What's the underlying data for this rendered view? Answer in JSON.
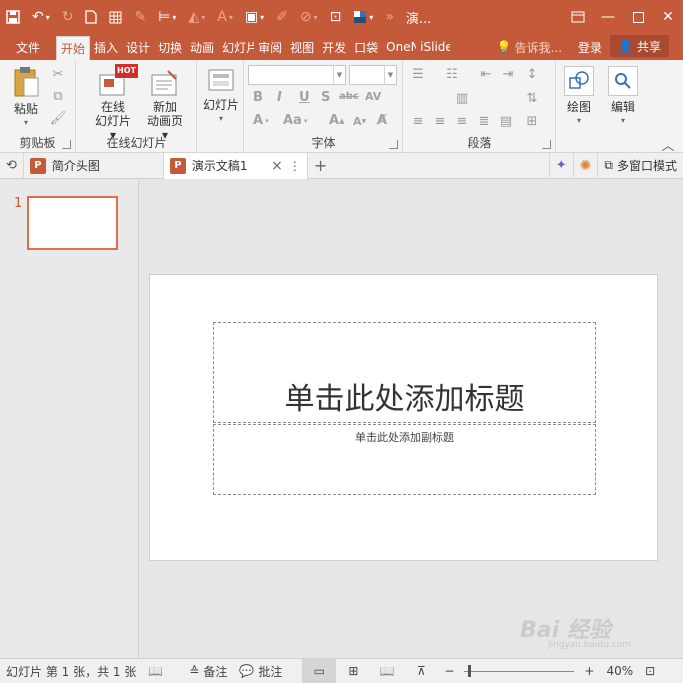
{
  "app": {
    "title": "演...",
    "share_label": "共享",
    "login_label": "登录",
    "tell_me": "告诉我..."
  },
  "quick_access": {
    "save": "save-icon",
    "undo": "undo-icon",
    "redo": "redo-icon"
  },
  "tabs": [
    "文件",
    "开始",
    "插入",
    "设计",
    "切换",
    "动画",
    "幻灯片",
    "审阅",
    "视图",
    "开发",
    "口袋",
    "OneN",
    "iSlide"
  ],
  "ribbon": {
    "clipboard": {
      "label": "剪贴板",
      "paste": "粘贴"
    },
    "online_slides": {
      "label": "在线幻灯片",
      "online": "在线",
      "online2": "幻灯片",
      "new_anim": "新加",
      "new_anim2": "动画页",
      "hot": "HOT"
    },
    "slides": {
      "slides_btn": "幻灯片"
    },
    "font": {
      "label": "字体",
      "bold": "B",
      "italic": "I",
      "underline": "U",
      "shadow": "S",
      "strike": "abc",
      "spacing": "AV",
      "size_up": "A",
      "size_down": "A",
      "case": "Aa"
    },
    "paragraph": {
      "label": "段落"
    },
    "drawing": {
      "draw": "绘图",
      "edit": "编辑"
    }
  },
  "doc_tabs": {
    "tab1": "简介头图",
    "tab2": "演示文稿1",
    "close": "×",
    "more": "⋮",
    "add": "+",
    "multi_window": "多窗口模式"
  },
  "thumbnail": {
    "number": "1"
  },
  "slide": {
    "title_placeholder": "单击此处添加标题",
    "subtitle_placeholder": "单击此处添加副标题"
  },
  "statusbar": {
    "slide_info": "幻灯片 第 1 张，共 1 张",
    "notes": "备注",
    "comments": "批注",
    "zoom_minus": "−",
    "zoom_plus": "+",
    "zoom_level": "40%",
    "zoom_fraction": 0.4
  },
  "watermark": {
    "brand": "Bai 经验",
    "url": "jingyan.baidu.com"
  },
  "colors": {
    "accent": "#c55a3b",
    "ribbon_bg": "#f3f3f3",
    "thumb_border": "#e46c4e"
  }
}
